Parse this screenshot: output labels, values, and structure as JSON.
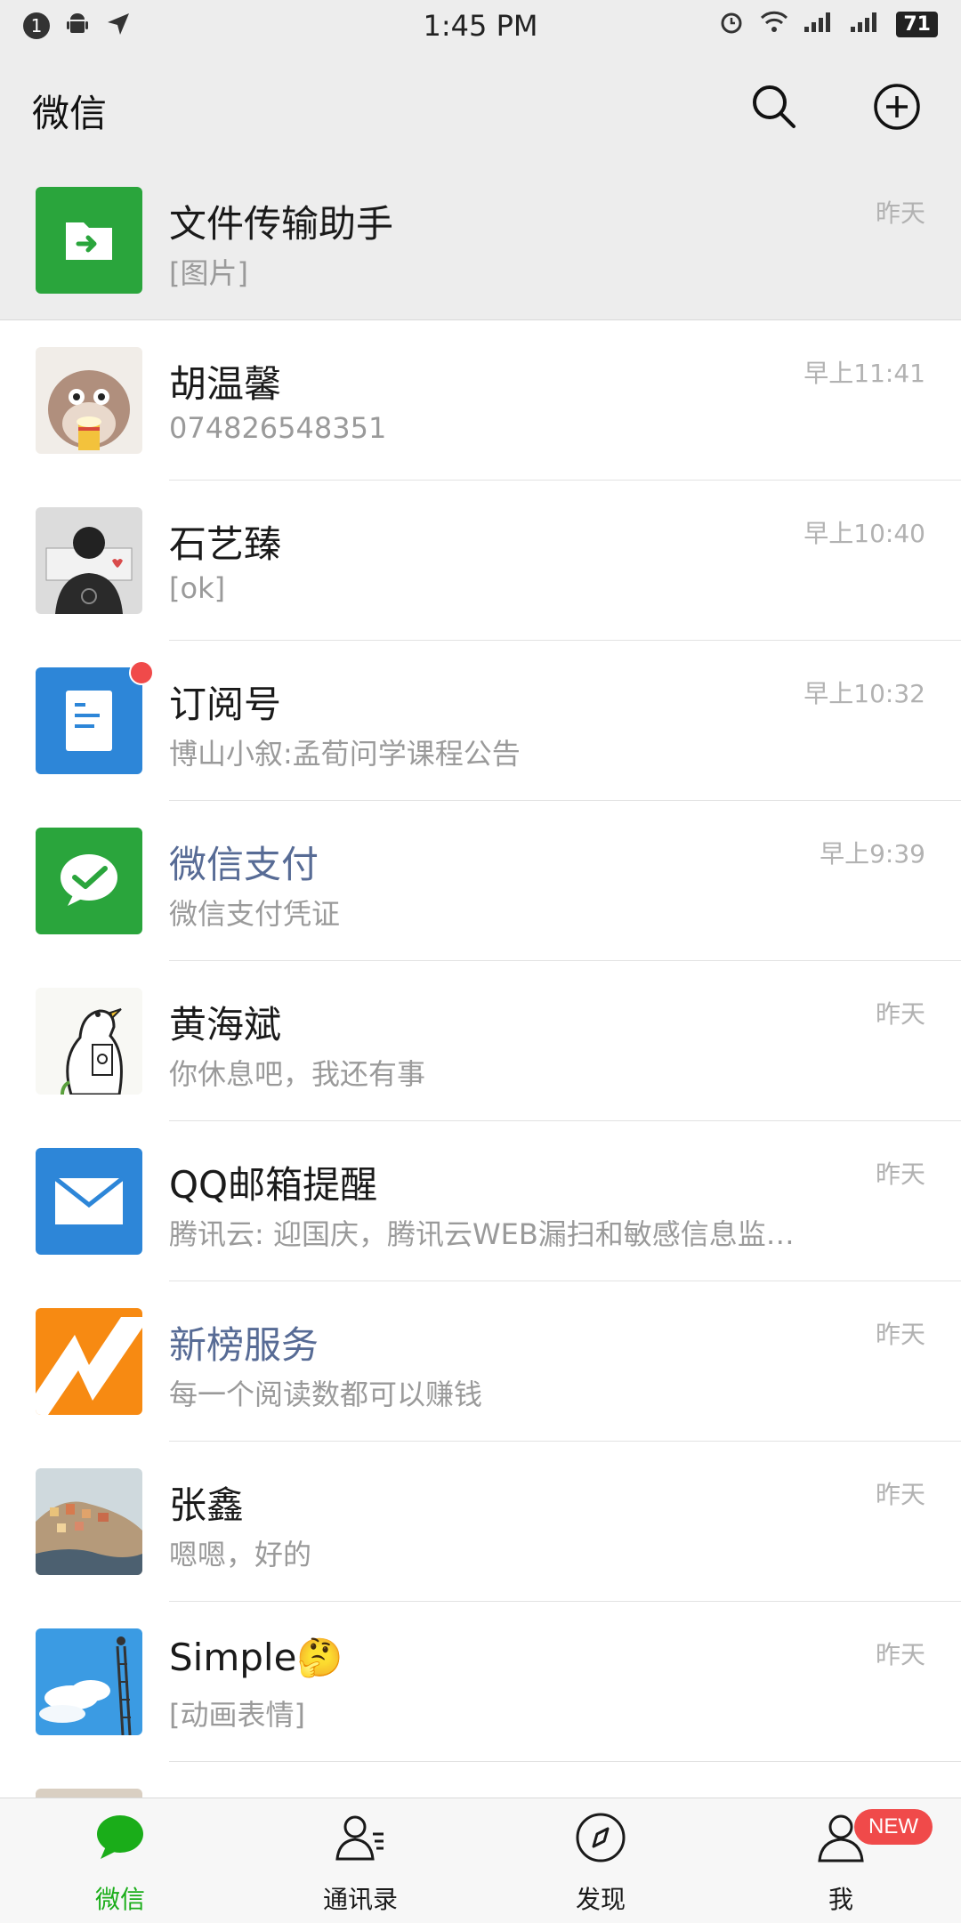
{
  "status_bar": {
    "notification_count": "1",
    "time": "1:45 PM",
    "battery": "71",
    "icons": [
      "android-icon",
      "location-icon",
      "alarm-icon",
      "wifi-icon",
      "signal-icon",
      "signal-icon-2",
      "battery-icon"
    ]
  },
  "header": {
    "title": "微信",
    "search_icon": "search-icon",
    "add_icon": "plus-circle-icon"
  },
  "chats": [
    {
      "name": "文件传输助手",
      "preview": "[图片]",
      "time": "昨天",
      "avatar": "file-transfer-icon",
      "avatar_color": "#2aa53c",
      "pinned": true
    },
    {
      "name": "胡温馨",
      "preview": "074826548351",
      "time": "早上11:41",
      "avatar": "hamster-avatar"
    },
    {
      "name": "石艺臻",
      "preview": "[ok]",
      "time": "早上10:40",
      "avatar": "person-avatar"
    },
    {
      "name": "订阅号",
      "preview": "博山小叙:孟荀问学课程公告",
      "time": "早上10:32",
      "avatar": "subscription-icon",
      "avatar_color": "#2d86d8",
      "unread": true
    },
    {
      "name": "微信支付",
      "preview": "微信支付凭证",
      "time": "早上9:39",
      "avatar": "wechat-pay-icon",
      "avatar_color": "#2aa53c",
      "official": true
    },
    {
      "name": "黄海斌",
      "preview": "你休息吧，我还有事",
      "time": "昨天",
      "avatar": "duck-avatar"
    },
    {
      "name": "QQ邮箱提醒",
      "preview": "腾讯云: 迎国庆，腾讯云WEB漏扫和敏感信息监…",
      "time": "昨天",
      "avatar": "mail-icon",
      "avatar_color": "#2d86d8"
    },
    {
      "name": "新榜服务",
      "preview": "每一个阅读数都可以赚钱",
      "time": "昨天",
      "avatar": "newrank-icon",
      "avatar_color": "#f78a12",
      "official": true
    },
    {
      "name": "张鑫",
      "preview": "嗯嗯，好的",
      "time": "昨天",
      "avatar": "landscape-avatar"
    },
    {
      "name": "Simple🤔",
      "preview": "[动画表情]",
      "time": "昨天",
      "avatar": "sky-avatar"
    }
  ],
  "tabs": [
    {
      "label": "微信",
      "icon": "chat-bubble-icon",
      "active": true
    },
    {
      "label": "通讯录",
      "icon": "contacts-icon"
    },
    {
      "label": "发现",
      "icon": "compass-icon"
    },
    {
      "label": "我",
      "icon": "person-icon",
      "badge": "NEW"
    }
  ]
}
